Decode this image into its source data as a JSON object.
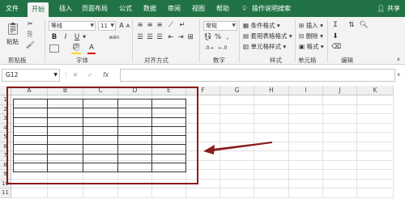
{
  "tabs": [
    {
      "label": "文件",
      "active": false
    },
    {
      "label": "开始",
      "active": true
    },
    {
      "label": "插入",
      "active": false
    },
    {
      "label": "页面布局",
      "active": false
    },
    {
      "label": "公式",
      "active": false
    },
    {
      "label": "数据",
      "active": false
    },
    {
      "label": "审阅",
      "active": false
    },
    {
      "label": "视图",
      "active": false
    },
    {
      "label": "帮助",
      "active": false
    }
  ],
  "tell_me": "操作说明搜索",
  "share": "共享",
  "ribbon": {
    "clipboard": {
      "paste": "粘贴",
      "label": "剪贴板"
    },
    "font": {
      "name": "等线",
      "size": "11",
      "bold": "B",
      "italic": "I",
      "underline": "U",
      "grow": "A",
      "shrink": "A",
      "wen": "wén",
      "color_a": "A",
      "label": "字体"
    },
    "alignment": {
      "label": "对齐方式"
    },
    "number": {
      "format": "常规",
      "percent": "%",
      "comma": ",",
      "label": "数字"
    },
    "styles": {
      "conditional": "条件格式",
      "table": "套用表格格式",
      "cell": "单元格样式",
      "label": "样式"
    },
    "cells": {
      "insert": "插入",
      "delete": "删除",
      "format": "格式",
      "label": "单元格"
    },
    "editing": {
      "sum": "Σ",
      "label": "编辑"
    }
  },
  "formula_bar": {
    "name_box": "G12",
    "fx": "fx",
    "cancel": "✕",
    "confirm": "✓",
    "value": ""
  },
  "columns": [
    "A",
    "B",
    "C",
    "D",
    "E",
    "F",
    "G",
    "H",
    "I",
    "J",
    "K"
  ],
  "rows": [
    "1",
    "2",
    "3",
    "4",
    "5",
    "6",
    "7",
    "8",
    "9",
    "10",
    "11"
  ],
  "colors": {
    "ribbon_green": "#217346",
    "annotation_red": "#8b1a1a"
  }
}
